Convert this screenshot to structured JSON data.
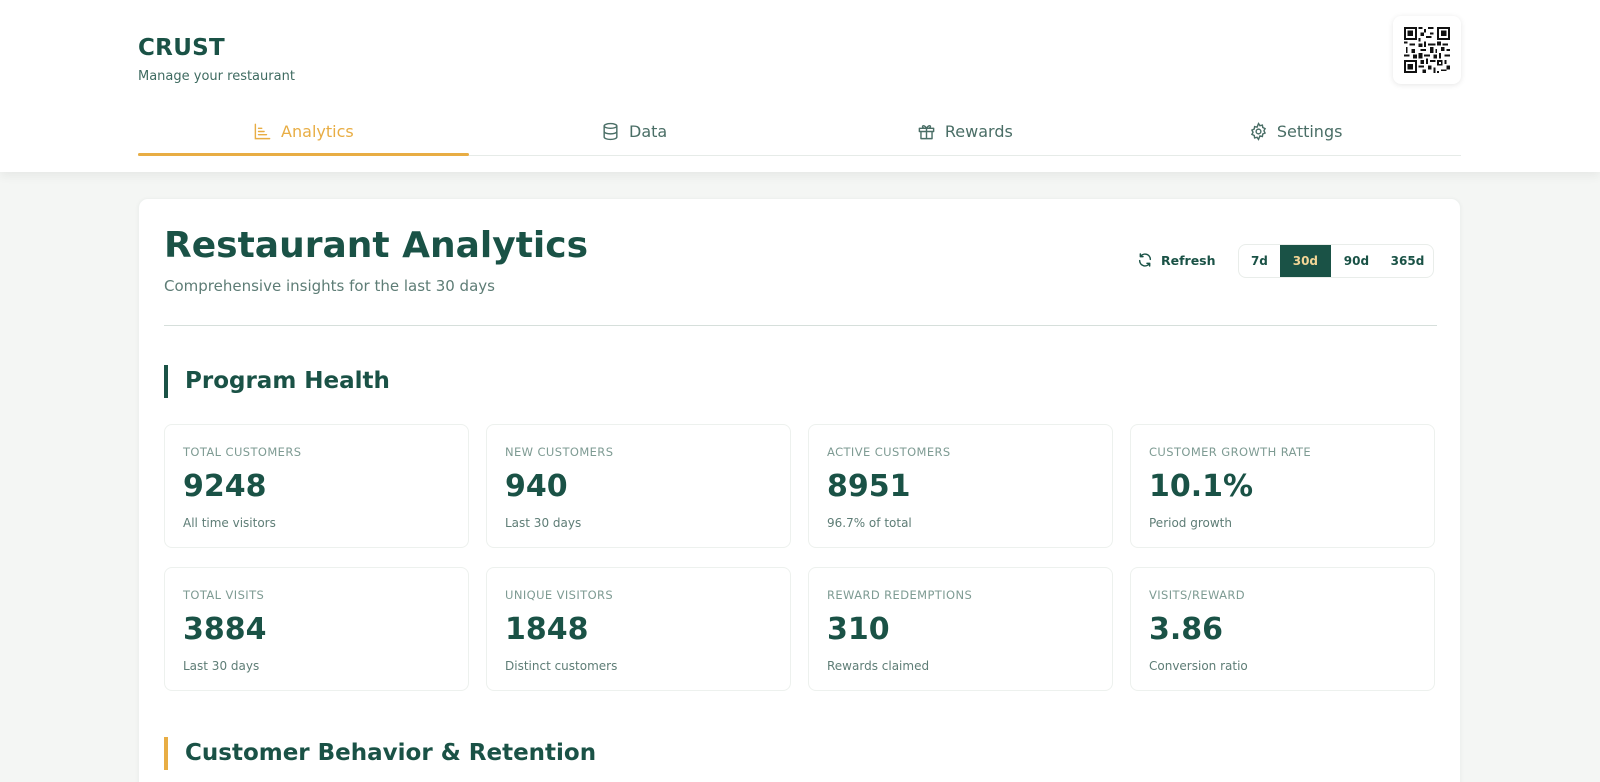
{
  "brand": {
    "title": "CRUST",
    "subtitle": "Manage your restaurant"
  },
  "header": {
    "qr_icon": "qr-code-icon"
  },
  "tabs": [
    {
      "label": "Analytics",
      "icon": "chart-icon",
      "active": true
    },
    {
      "label": "Data",
      "icon": "database-icon",
      "active": false
    },
    {
      "label": "Rewards",
      "icon": "gift-icon",
      "active": false
    },
    {
      "label": "Settings",
      "icon": "gear-icon",
      "active": false
    }
  ],
  "page": {
    "title": "Restaurant Analytics",
    "subtitle": "Comprehensive insights for the last 30 days",
    "refresh_label": "Refresh",
    "ranges": [
      "7d",
      "30d",
      "90d",
      "365d"
    ],
    "selected_range": "30d"
  },
  "sections": {
    "program_health": "Program Health",
    "behavior": "Customer Behavior & Retention"
  },
  "stats": [
    {
      "label": "TOTAL CUSTOMERS",
      "value": "9248",
      "note": "All time visitors"
    },
    {
      "label": "NEW CUSTOMERS",
      "value": "940",
      "note": "Last 30 days"
    },
    {
      "label": "ACTIVE CUSTOMERS",
      "value": "8951",
      "note": "96.7% of total"
    },
    {
      "label": "CUSTOMER GROWTH RATE",
      "value": "10.1%",
      "note": "Period growth"
    },
    {
      "label": "TOTAL VISITS",
      "value": "3884",
      "note": "Last 30 days"
    },
    {
      "label": "UNIQUE VISITORS",
      "value": "1848",
      "note": "Distinct customers"
    },
    {
      "label": "REWARD REDEMPTIONS",
      "value": "310",
      "note": "Rewards claimed"
    },
    {
      "label": "VISITS/REWARD",
      "value": "3.86",
      "note": "Conversion ratio"
    }
  ],
  "colors": {
    "primary": "#1a5246",
    "accent": "#e8ad44",
    "background": "#f4f6f4"
  }
}
